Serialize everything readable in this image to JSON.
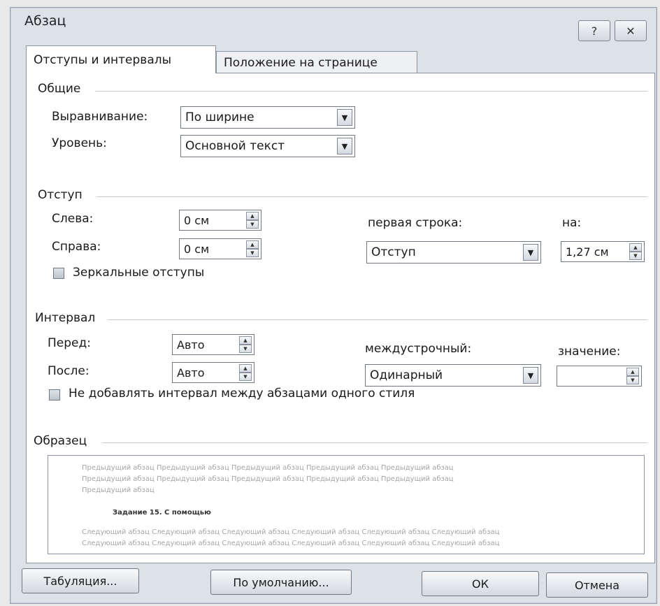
{
  "window": {
    "title": "Абзац",
    "help_icon": "question-icon",
    "close_icon": "close-icon"
  },
  "tabs": [
    {
      "label": "Отступы и интервалы",
      "active": true
    },
    {
      "label": "Положение на странице",
      "active": false
    }
  ],
  "general": {
    "heading": "Общие",
    "alignment_label": "Выравнивание:",
    "alignment_value": "По ширине",
    "level_label": "Уровень:",
    "level_value": "Основной текст"
  },
  "indent": {
    "heading": "Отступ",
    "left_label": "Слева:",
    "left_value": "0 см",
    "right_label": "Справа:",
    "right_value": "0 см",
    "first_line_label": "первая строка:",
    "first_line_value": "Отступ",
    "by_label": "на:",
    "by_value": "1,27 см",
    "mirror_label": "Зеркальные отступы"
  },
  "spacing": {
    "heading": "Интервал",
    "before_label": "Перед:",
    "before_value": "Авто",
    "after_label": "После:",
    "after_value": "Авто",
    "line_label": "междустрочный:",
    "line_value": "Одинарный",
    "value_label": "значение:",
    "value_value": "",
    "no_space_label": "Не добавлять интервал между абзацами одного стиля"
  },
  "sample": {
    "heading": "Образец",
    "prev_lines": [
      "Предыдущий абзац Предыдущий абзац Предыдущий абзац Предыдущий абзац Предыдущий абзац",
      "Предыдущий абзац Предыдущий абзац Предыдущий абзац Предыдущий абзац Предыдущий абзац",
      "Предыдущий абзац"
    ],
    "sample_text": "Задание 15. С помощью",
    "next_lines": [
      "Следующий абзац Следующий абзац Следующий абзац Следующий абзац Следующий абзац Следующий абзац",
      "Следующий абзац Следующий абзац Следующий абзац Следующий абзац Следующий абзац Следующий абзац"
    ]
  },
  "buttons": {
    "tabs": "Табуляция...",
    "default": "По умолчанию...",
    "ok": "ОК",
    "cancel": "Отмена"
  }
}
